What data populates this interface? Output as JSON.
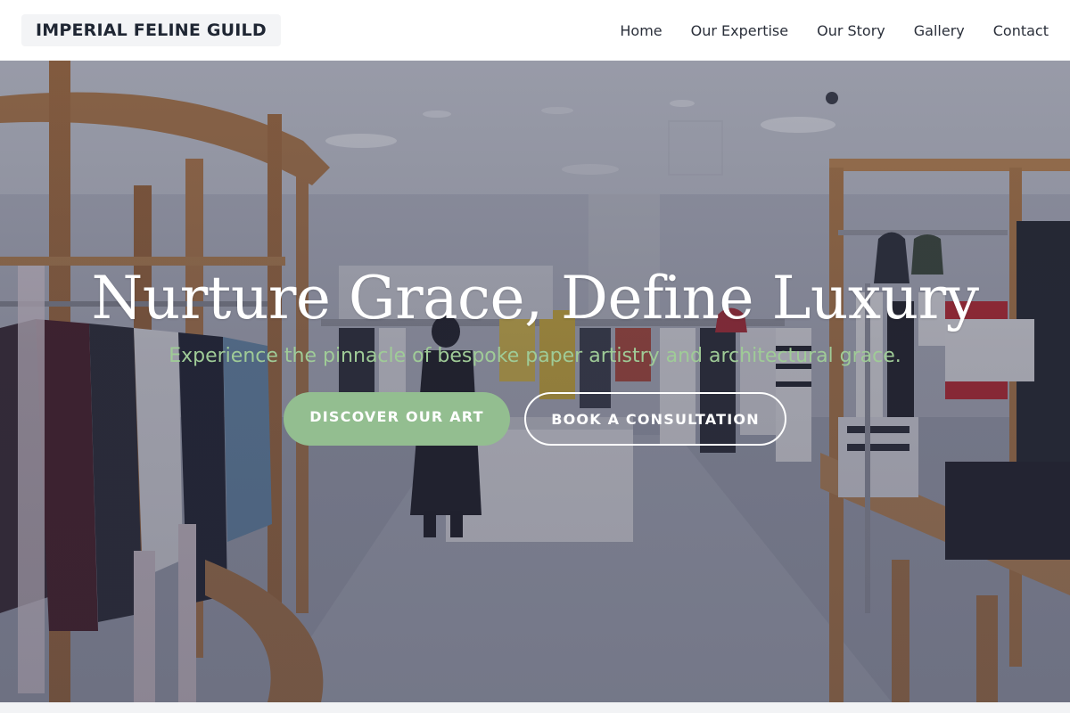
{
  "header": {
    "logo": "IMPERIAL FELINE GUILD",
    "nav": [
      {
        "label": "Home"
      },
      {
        "label": "Our Expertise"
      },
      {
        "label": "Our Story"
      },
      {
        "label": "Gallery"
      },
      {
        "label": "Contact"
      }
    ]
  },
  "hero": {
    "title": "Nurture Grace, Define Luxury",
    "subtitle": "Experience the pinnacle of bespoke paper artistry and architectural grace.",
    "buttons": {
      "primary": "DISCOVER OUR ART",
      "secondary": "BOOK A CONSULTATION"
    },
    "background": "boutique-interior-photo"
  },
  "colors": {
    "accent_green": "#93be90",
    "subtitle_green": "#9fcb97",
    "header_bg": "#ffffff",
    "logo_bg": "#f3f4f6",
    "text_dark": "#1f2633"
  }
}
